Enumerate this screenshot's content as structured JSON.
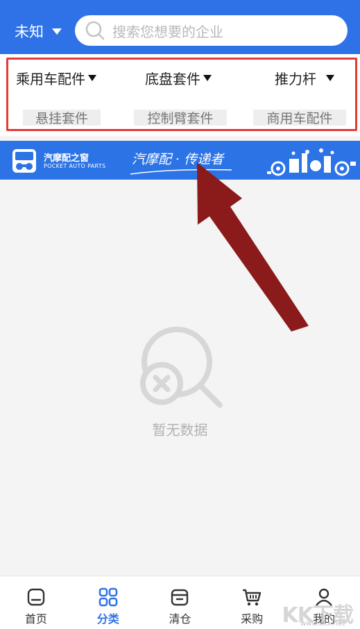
{
  "header": {
    "location": "未知",
    "search_placeholder": "搜索您想要的企业"
  },
  "filters": {
    "selects": [
      "乘用车配件",
      "底盘套件",
      "推力杆"
    ],
    "chips": [
      "悬挂套件",
      "控制臂套件",
      "商用车配件"
    ]
  },
  "banner": {
    "brand_cn": "汽摩配之窗",
    "brand_en": "POCKET AUTO PARTS",
    "slogan": "汽摩配 · 传递者"
  },
  "empty": {
    "text": "暂无数据"
  },
  "tabs": [
    {
      "label": "首页",
      "icon": "home-icon"
    },
    {
      "label": "分类",
      "icon": "category-icon",
      "active": true
    },
    {
      "label": "清仓",
      "icon": "clearance-box-icon"
    },
    {
      "label": "采购",
      "icon": "cart-icon"
    },
    {
      "label": "我的",
      "icon": "user-icon"
    }
  ],
  "watermark": {
    "text": "KK下载",
    "url": "www.kkx.net"
  },
  "colors": {
    "primary": "#2f72e7",
    "highlight": "#e53935",
    "arrow": "#8b1a1a"
  }
}
